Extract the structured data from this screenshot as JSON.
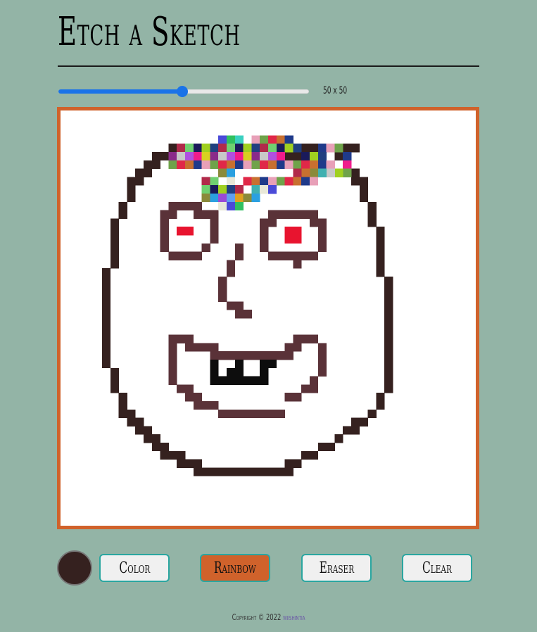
{
  "header": {
    "title": "Etch a Sketch"
  },
  "grid_size": {
    "label": "50 x 50",
    "slider_value": 50,
    "slider_min": 1,
    "slider_max": 100
  },
  "colors": {
    "background": "#93b4a6",
    "board_border": "#d0622b",
    "board_fill": "#ffffff",
    "current_color": "#35211f",
    "button_border": "#2aa6a0",
    "button_fill": "#f0f0f0",
    "active_button_fill": "#d0622b",
    "slider_accent": "#1a73e8"
  },
  "controls": {
    "color_label": "Color",
    "rainbow_label": "Rainbow",
    "eraser_label": "Eraser",
    "clear_label": "Clear",
    "active_mode": "Rainbow"
  },
  "footer": {
    "copyright": "Copyright © 2022",
    "author": "wiishintia"
  }
}
